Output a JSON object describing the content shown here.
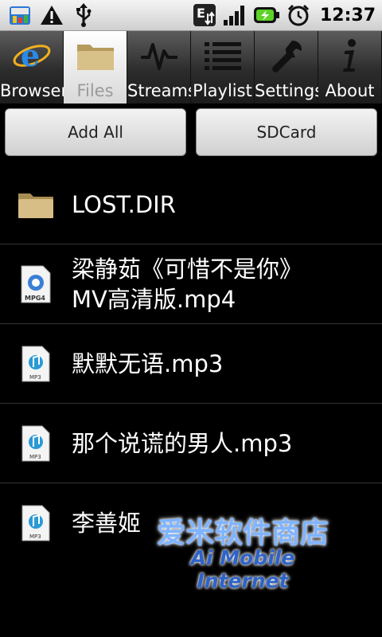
{
  "status_bar": {
    "time": "12:37",
    "left_icons": [
      "app-notification-icon",
      "warning-icon",
      "usb-icon"
    ],
    "right_icons": [
      "edge-signal-icon",
      "signal-bars-icon",
      "battery-charging-icon",
      "alarm-icon"
    ],
    "edge_letter": "E"
  },
  "tabs": [
    {
      "label": "Browser",
      "icon": "browser-icon",
      "active": false
    },
    {
      "label": "Files",
      "icon": "folder-icon",
      "active": true
    },
    {
      "label": "Streams",
      "icon": "streams-icon",
      "active": false
    },
    {
      "label": "Playlist",
      "icon": "playlist-icon",
      "active": false
    },
    {
      "label": "Settings",
      "icon": "wrench-icon",
      "active": false
    },
    {
      "label": "About",
      "icon": "info-icon",
      "active": false
    }
  ],
  "buttons": {
    "add_all": "Add All",
    "sdcard": "SDCard"
  },
  "files": [
    {
      "name": "LOST.DIR",
      "icon": "folder-icon"
    },
    {
      "name": "梁静茹《可惜不是你》MV高清版.mp4",
      "icon": "mp4-file-icon"
    },
    {
      "name": "默默无语.mp3",
      "icon": "mp3-file-icon"
    },
    {
      "name": "那个说谎的男人.mp3",
      "icon": "mp3-file-icon"
    },
    {
      "name": "李善姬",
      "icon": "mp3-file-icon"
    }
  ],
  "watermark": {
    "line1": "爱米软件商店",
    "line2": "Ai Mobile Internet"
  },
  "icon_labels": {
    "mp4": "MPG4",
    "mp3": "MP3"
  },
  "colors": {
    "background": "#000000",
    "status_bar": "#dcdcdc",
    "tab_active": "#ffffff",
    "tab_inactive": "#3a3a3a",
    "button": "#e0e0e0"
  }
}
